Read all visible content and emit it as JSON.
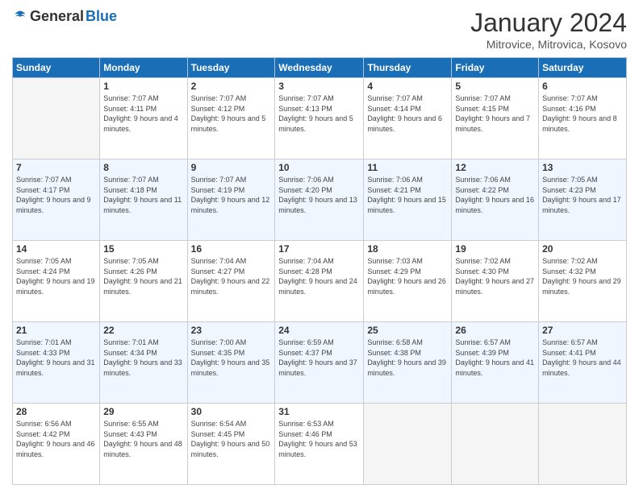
{
  "header": {
    "logo": {
      "general": "General",
      "blue": "Blue"
    },
    "title": "January 2024",
    "subtitle": "Mitrovice, Mitrovica, Kosovo"
  },
  "days_of_week": [
    "Sunday",
    "Monday",
    "Tuesday",
    "Wednesday",
    "Thursday",
    "Friday",
    "Saturday"
  ],
  "weeks": [
    [
      {
        "date": "",
        "sunrise": "",
        "sunset": "",
        "daylight": ""
      },
      {
        "date": "1",
        "sunrise": "Sunrise: 7:07 AM",
        "sunset": "Sunset: 4:11 PM",
        "daylight": "Daylight: 9 hours and 4 minutes."
      },
      {
        "date": "2",
        "sunrise": "Sunrise: 7:07 AM",
        "sunset": "Sunset: 4:12 PM",
        "daylight": "Daylight: 9 hours and 5 minutes."
      },
      {
        "date": "3",
        "sunrise": "Sunrise: 7:07 AM",
        "sunset": "Sunset: 4:13 PM",
        "daylight": "Daylight: 9 hours and 5 minutes."
      },
      {
        "date": "4",
        "sunrise": "Sunrise: 7:07 AM",
        "sunset": "Sunset: 4:14 PM",
        "daylight": "Daylight: 9 hours and 6 minutes."
      },
      {
        "date": "5",
        "sunrise": "Sunrise: 7:07 AM",
        "sunset": "Sunset: 4:15 PM",
        "daylight": "Daylight: 9 hours and 7 minutes."
      },
      {
        "date": "6",
        "sunrise": "Sunrise: 7:07 AM",
        "sunset": "Sunset: 4:16 PM",
        "daylight": "Daylight: 9 hours and 8 minutes."
      }
    ],
    [
      {
        "date": "7",
        "sunrise": "Sunrise: 7:07 AM",
        "sunset": "Sunset: 4:17 PM",
        "daylight": "Daylight: 9 hours and 9 minutes."
      },
      {
        "date": "8",
        "sunrise": "Sunrise: 7:07 AM",
        "sunset": "Sunset: 4:18 PM",
        "daylight": "Daylight: 9 hours and 11 minutes."
      },
      {
        "date": "9",
        "sunrise": "Sunrise: 7:07 AM",
        "sunset": "Sunset: 4:19 PM",
        "daylight": "Daylight: 9 hours and 12 minutes."
      },
      {
        "date": "10",
        "sunrise": "Sunrise: 7:06 AM",
        "sunset": "Sunset: 4:20 PM",
        "daylight": "Daylight: 9 hours and 13 minutes."
      },
      {
        "date": "11",
        "sunrise": "Sunrise: 7:06 AM",
        "sunset": "Sunset: 4:21 PM",
        "daylight": "Daylight: 9 hours and 15 minutes."
      },
      {
        "date": "12",
        "sunrise": "Sunrise: 7:06 AM",
        "sunset": "Sunset: 4:22 PM",
        "daylight": "Daylight: 9 hours and 16 minutes."
      },
      {
        "date": "13",
        "sunrise": "Sunrise: 7:05 AM",
        "sunset": "Sunset: 4:23 PM",
        "daylight": "Daylight: 9 hours and 17 minutes."
      }
    ],
    [
      {
        "date": "14",
        "sunrise": "Sunrise: 7:05 AM",
        "sunset": "Sunset: 4:24 PM",
        "daylight": "Daylight: 9 hours and 19 minutes."
      },
      {
        "date": "15",
        "sunrise": "Sunrise: 7:05 AM",
        "sunset": "Sunset: 4:26 PM",
        "daylight": "Daylight: 9 hours and 21 minutes."
      },
      {
        "date": "16",
        "sunrise": "Sunrise: 7:04 AM",
        "sunset": "Sunset: 4:27 PM",
        "daylight": "Daylight: 9 hours and 22 minutes."
      },
      {
        "date": "17",
        "sunrise": "Sunrise: 7:04 AM",
        "sunset": "Sunset: 4:28 PM",
        "daylight": "Daylight: 9 hours and 24 minutes."
      },
      {
        "date": "18",
        "sunrise": "Sunrise: 7:03 AM",
        "sunset": "Sunset: 4:29 PM",
        "daylight": "Daylight: 9 hours and 26 minutes."
      },
      {
        "date": "19",
        "sunrise": "Sunrise: 7:02 AM",
        "sunset": "Sunset: 4:30 PM",
        "daylight": "Daylight: 9 hours and 27 minutes."
      },
      {
        "date": "20",
        "sunrise": "Sunrise: 7:02 AM",
        "sunset": "Sunset: 4:32 PM",
        "daylight": "Daylight: 9 hours and 29 minutes."
      }
    ],
    [
      {
        "date": "21",
        "sunrise": "Sunrise: 7:01 AM",
        "sunset": "Sunset: 4:33 PM",
        "daylight": "Daylight: 9 hours and 31 minutes."
      },
      {
        "date": "22",
        "sunrise": "Sunrise: 7:01 AM",
        "sunset": "Sunset: 4:34 PM",
        "daylight": "Daylight: 9 hours and 33 minutes."
      },
      {
        "date": "23",
        "sunrise": "Sunrise: 7:00 AM",
        "sunset": "Sunset: 4:35 PM",
        "daylight": "Daylight: 9 hours and 35 minutes."
      },
      {
        "date": "24",
        "sunrise": "Sunrise: 6:59 AM",
        "sunset": "Sunset: 4:37 PM",
        "daylight": "Daylight: 9 hours and 37 minutes."
      },
      {
        "date": "25",
        "sunrise": "Sunrise: 6:58 AM",
        "sunset": "Sunset: 4:38 PM",
        "daylight": "Daylight: 9 hours and 39 minutes."
      },
      {
        "date": "26",
        "sunrise": "Sunrise: 6:57 AM",
        "sunset": "Sunset: 4:39 PM",
        "daylight": "Daylight: 9 hours and 41 minutes."
      },
      {
        "date": "27",
        "sunrise": "Sunrise: 6:57 AM",
        "sunset": "Sunset: 4:41 PM",
        "daylight": "Daylight: 9 hours and 44 minutes."
      }
    ],
    [
      {
        "date": "28",
        "sunrise": "Sunrise: 6:56 AM",
        "sunset": "Sunset: 4:42 PM",
        "daylight": "Daylight: 9 hours and 46 minutes."
      },
      {
        "date": "29",
        "sunrise": "Sunrise: 6:55 AM",
        "sunset": "Sunset: 4:43 PM",
        "daylight": "Daylight: 9 hours and 48 minutes."
      },
      {
        "date": "30",
        "sunrise": "Sunrise: 6:54 AM",
        "sunset": "Sunset: 4:45 PM",
        "daylight": "Daylight: 9 hours and 50 minutes."
      },
      {
        "date": "31",
        "sunrise": "Sunrise: 6:53 AM",
        "sunset": "Sunset: 4:46 PM",
        "daylight": "Daylight: 9 hours and 53 minutes."
      },
      {
        "date": "",
        "sunrise": "",
        "sunset": "",
        "daylight": ""
      },
      {
        "date": "",
        "sunrise": "",
        "sunset": "",
        "daylight": ""
      },
      {
        "date": "",
        "sunrise": "",
        "sunset": "",
        "daylight": ""
      }
    ]
  ]
}
